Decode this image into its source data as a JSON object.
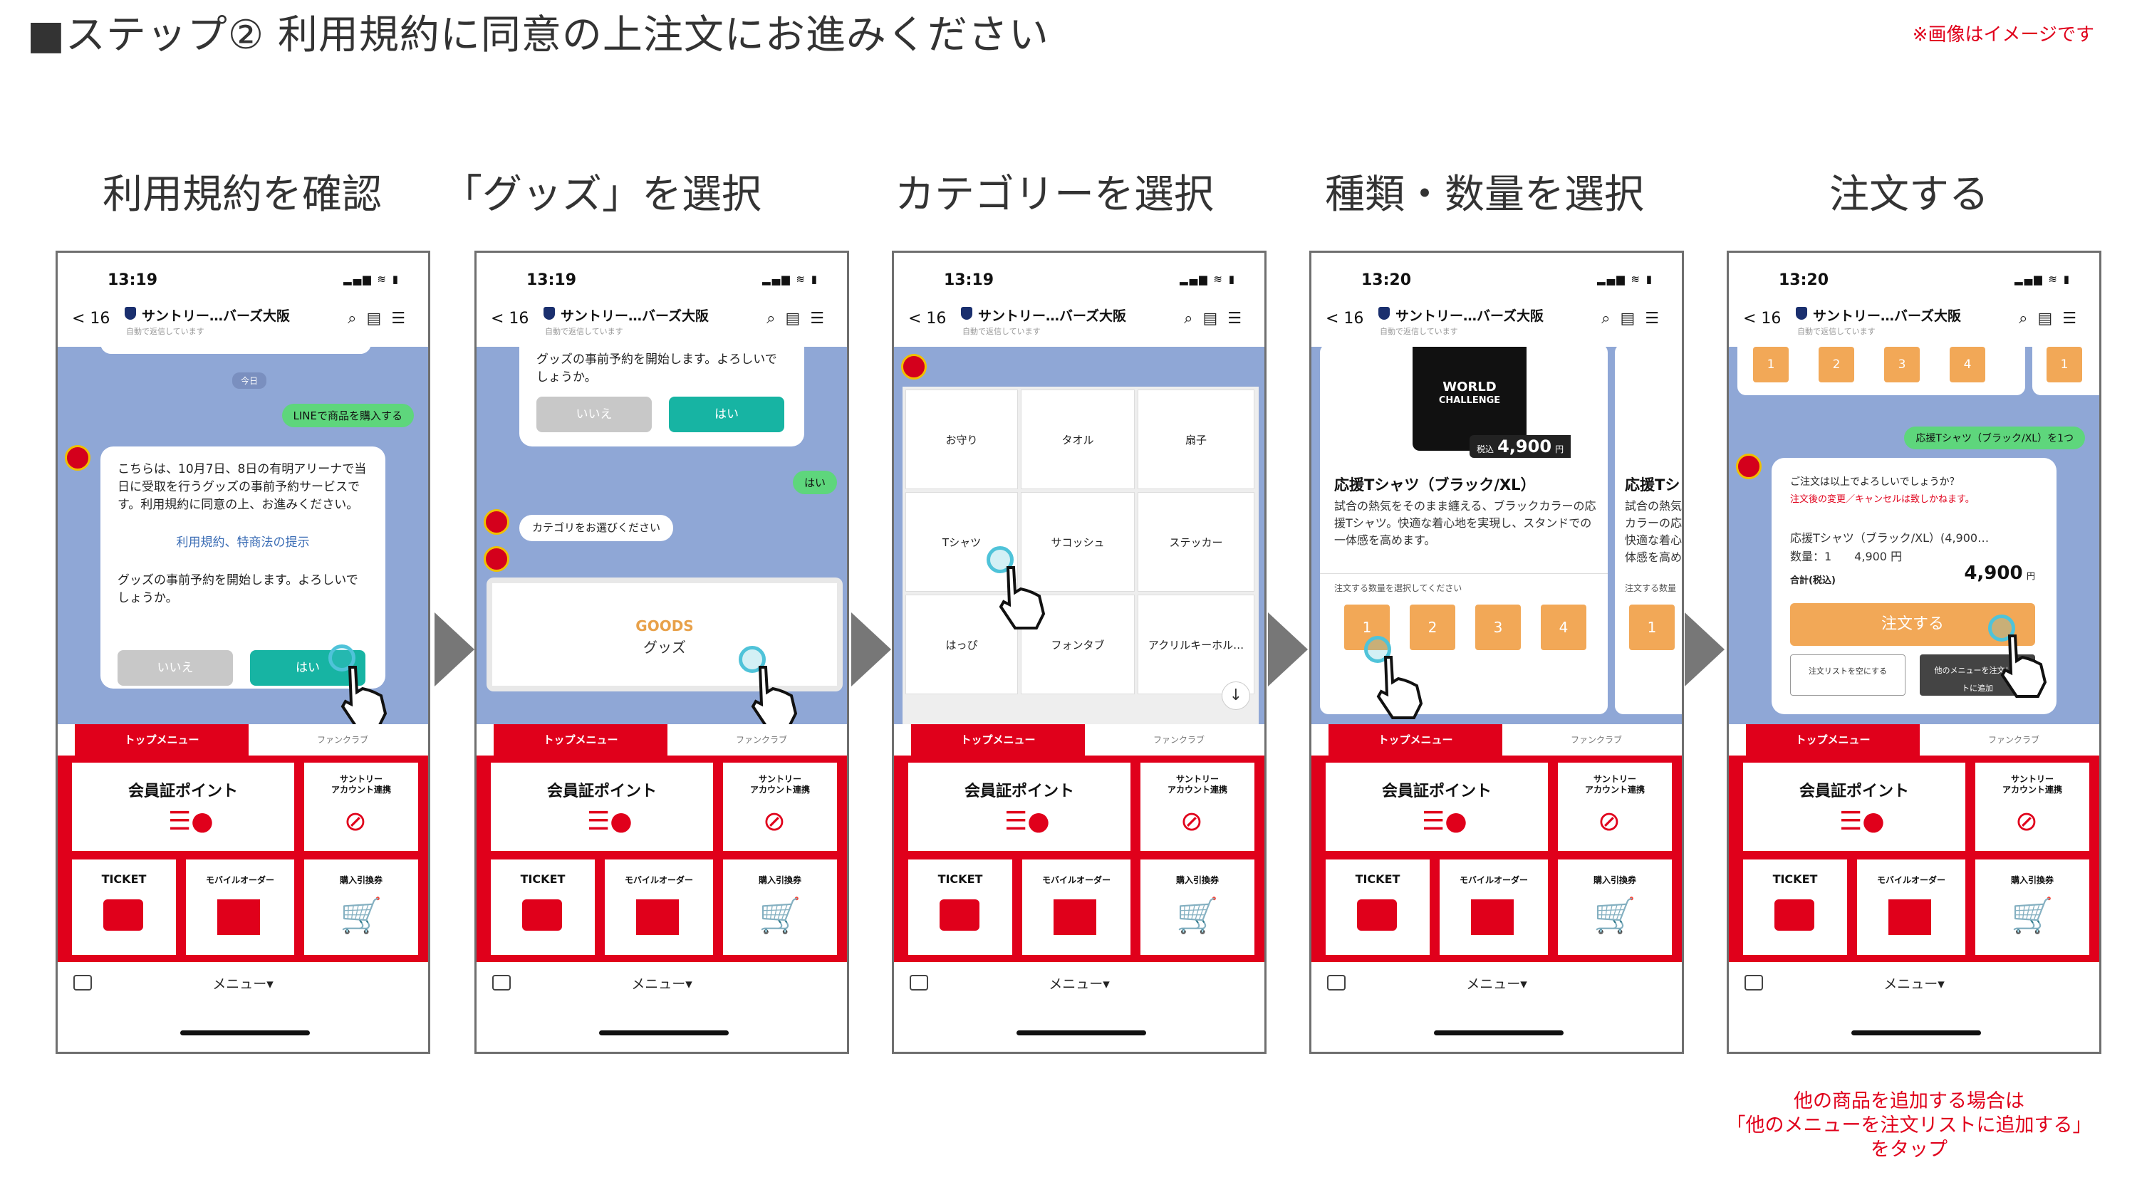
{
  "page": {
    "title": "■ステップ② 利用規約に同意の上注文にお進みください",
    "image_note": "※画像はイメージです",
    "footnote_line1": "他の商品を追加する場合は",
    "footnote_line2": "「他のメニューを注文リストに追加する」",
    "footnote_line3": "をタップ"
  },
  "steps": [
    {
      "title": "利用規約を確認"
    },
    {
      "title": "「グッズ」を選択"
    },
    {
      "title": "カテゴリーを選択"
    },
    {
      "title": "種類・数量を選択"
    },
    {
      "title": "注文する"
    }
  ],
  "phone_common": {
    "back": "< 16",
    "account_name": "サントリー…バーズ大阪",
    "account_sub": "自動で返信しています",
    "tab_top": "トップメニュー",
    "tab_fanclub": "ファンクラブ",
    "tile_member": "会員証ポイント",
    "tile_suntory": "サントリー\nアカウント連携",
    "tile_ticket": "TICKET",
    "tile_mobile": "モバイルオーダー",
    "tile_voucher": "購入引換券",
    "menu_label": "メニュー▾"
  },
  "phone1": {
    "time": "13:19",
    "date_chip": "今日",
    "user_msg": "LINEで商品を購入する",
    "bot_msg": "こちらは、10月7日、8日の有明アリーナで当日に受取を行うグッズの事前予約サービスです。利用規約に同意の上、お進みください。",
    "terms_link": "利用規約、特商法の提示",
    "confirm_msg": "グッズの事前予約を開始します。よろしいでしょうか。",
    "no": "いいえ",
    "yes": "はい"
  },
  "phone2": {
    "time": "13:19",
    "confirm_msg": "グッズの事前予約を開始します。よろしいでしょうか。",
    "no": "いいえ",
    "yes": "はい",
    "user_reply": "はい",
    "bot_msg": "カテゴリをお選びください",
    "goods_en": "GOODS",
    "goods_jp": "グッズ"
  },
  "phone3": {
    "time": "13:19",
    "categories": [
      "お守り",
      "タオル",
      "扇子",
      "Tシャツ",
      "サコッシュ",
      "ステッカー",
      "はっぴ",
      "フォンタブ",
      "アクリルキーホル…"
    ]
  },
  "phone4": {
    "time": "13:20",
    "price_prefix": "税込",
    "price": "4,900",
    "price_unit": "円",
    "shirt_text1": "WORLD",
    "shirt_text2": "CHALLENGE",
    "product_name": "応援Tシャツ（ブラック/XL）",
    "product_desc": "試合の熱気をそのまま纏える、ブラックカラーの応援Tシャツ。快適な着心地を実現し、スタンドでの一体感を高めます。",
    "qty_label": "注文する数量を選択してください",
    "quantities": [
      "1",
      "2",
      "3",
      "4"
    ],
    "next_name": "応援Tシ",
    "next_desc": "試合の熱気カラーの応快適な着心体感を高め",
    "next_qty_label": "注文する数量",
    "next_qty": "1"
  },
  "phone5": {
    "time": "13:20",
    "quantities": [
      "1",
      "2",
      "3",
      "4",
      "1"
    ],
    "user_msg": "応援Tシャツ（ブラック/XL）を1つ",
    "confirm": "ご注文は以上でよろしいでしょうか？",
    "warning": "注文後の変更／キャンセルは致しかねます。",
    "item": "応援Tシャツ（ブラック/XL）(4,900…",
    "qty": "数量：1　　4,900 円",
    "total_label": "合計(税込)",
    "total": "4,900",
    "total_unit": "円",
    "order_btn": "注文する",
    "clear_btn": "注文リストを空にする",
    "add_btn": "他のメニューを注文リストに追加"
  }
}
